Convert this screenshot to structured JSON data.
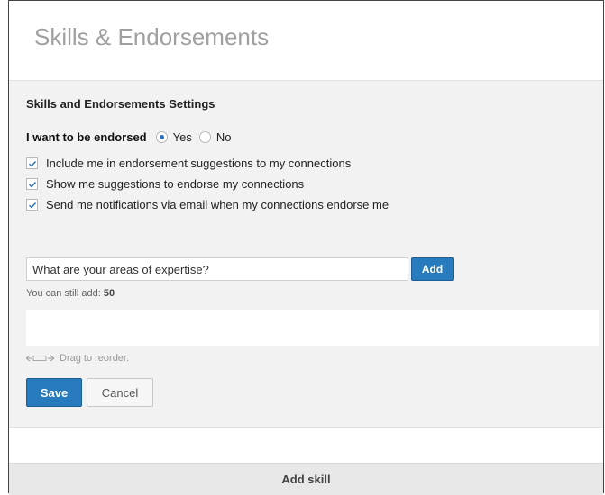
{
  "header": {
    "title": "Skills & Endorsements"
  },
  "settings": {
    "title": "Skills and Endorsements Settings",
    "endorse_label": "I want to be endorsed",
    "options": {
      "yes": "Yes",
      "no": "No",
      "selected": "Yes"
    },
    "checkboxes": [
      {
        "label": "Include me in endorsement suggestions to my connections",
        "checked": true
      },
      {
        "label": "Show me suggestions to endorse my connections",
        "checked": true
      },
      {
        "label": "Send me notifications via email when my connections endorse me",
        "checked": true
      }
    ]
  },
  "skills": {
    "input_placeholder": "What are your areas of expertise?",
    "add_label": "Add",
    "can_add_prefix": "You can still add:",
    "can_add_count": "50",
    "drag_hint": "Drag to reorder."
  },
  "actions": {
    "save_label": "Save",
    "cancel_label": "Cancel"
  },
  "footer": {
    "add_skill_label": "Add skill"
  },
  "colors": {
    "accent": "#287bbc",
    "panel_bg": "#f2f2f2",
    "footer_bg": "#e8e8e8"
  }
}
